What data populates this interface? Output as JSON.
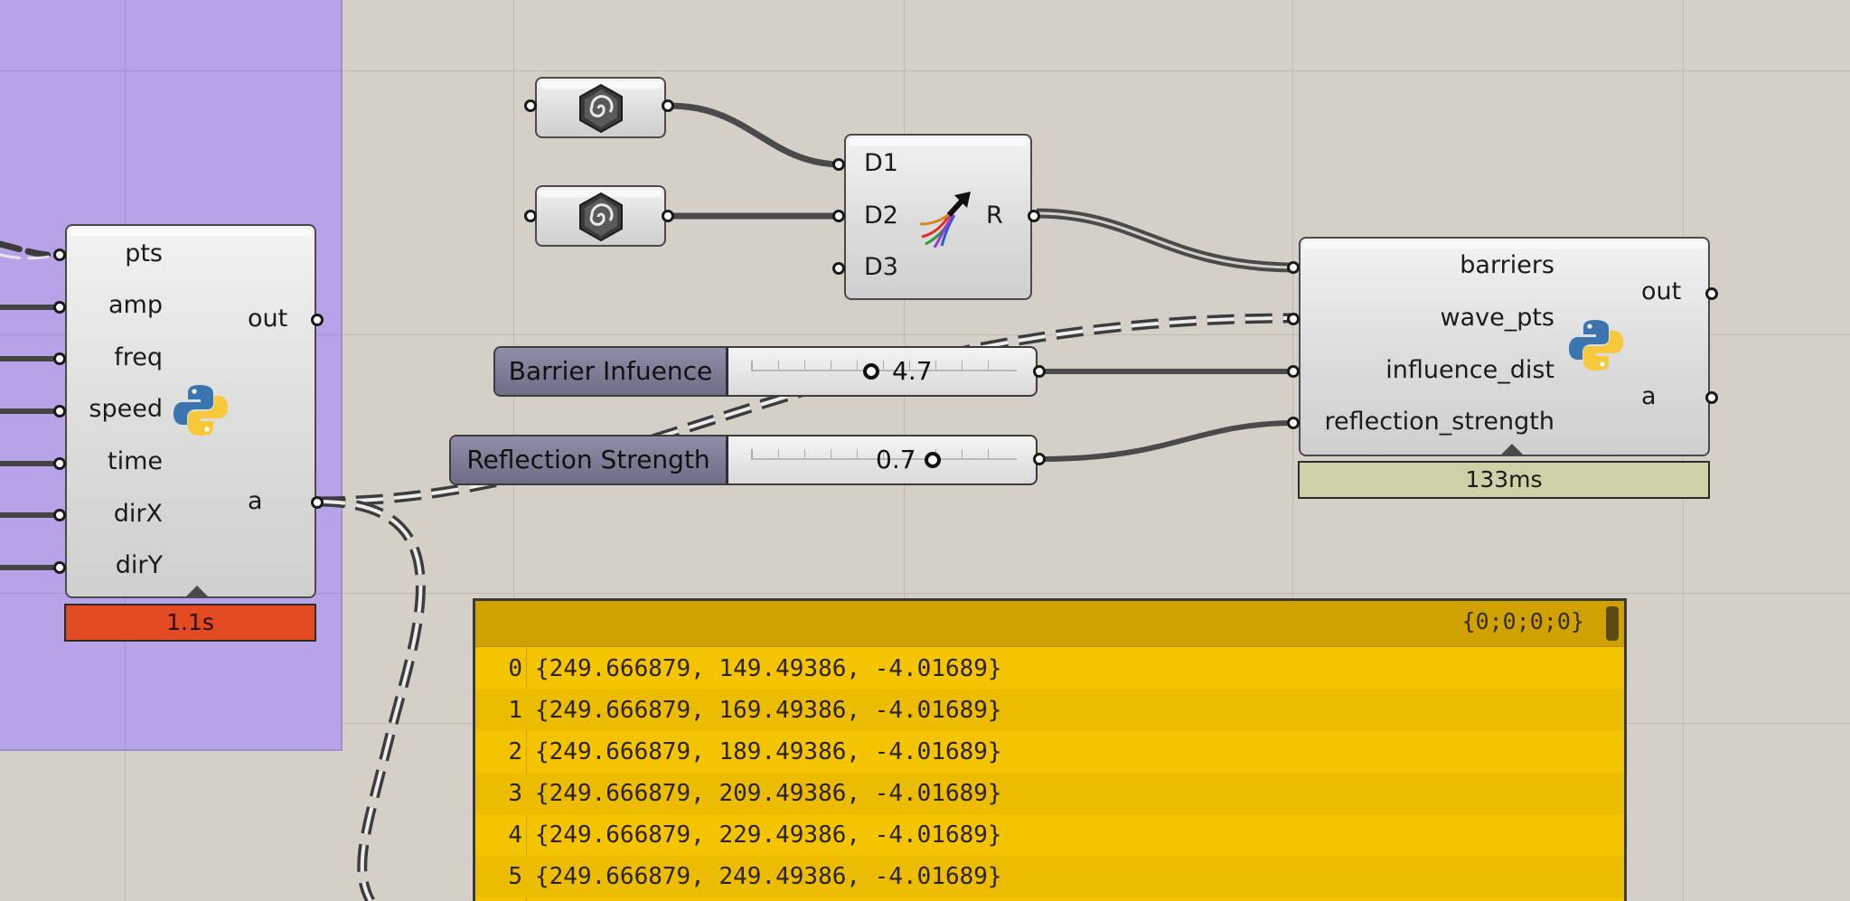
{
  "component_left": {
    "inputs": [
      "pts",
      "amp",
      "freq",
      "speed",
      "time",
      "dirX",
      "dirY"
    ],
    "outputs": [
      "out",
      "a"
    ],
    "icon": "python-icon",
    "timer": "1.1s"
  },
  "merge": {
    "inputs": [
      "D1",
      "D2",
      "D3"
    ],
    "output": "R",
    "icon": "merge-arrows-icon"
  },
  "component_right": {
    "inputs": [
      "barriers",
      "wave_pts",
      "influence_dist",
      "reflection_strength"
    ],
    "outputs": [
      "out",
      "a"
    ],
    "icon": "python-icon",
    "timer": "133ms"
  },
  "sliders": [
    {
      "name": "Barrier Infuence",
      "value": "4.7"
    },
    {
      "name": "Reflection Strength",
      "value": "0.7"
    }
  ],
  "geometry_params": [
    {
      "icon": "geometry-parameter-icon"
    },
    {
      "icon": "geometry-parameter-icon"
    }
  ],
  "panel": {
    "path": "{0;0;0;0}",
    "rows": [
      {
        "index": "0",
        "value": "{249.666879, 149.49386, -4.01689}"
      },
      {
        "index": "1",
        "value": "{249.666879, 169.49386, -4.01689}"
      },
      {
        "index": "2",
        "value": "{249.666879, 189.49386, -4.01689}"
      },
      {
        "index": "3",
        "value": "{249.666879, 209.49386, -4.01689}"
      },
      {
        "index": "4",
        "value": "{249.666879, 229.49386, -4.01689}"
      },
      {
        "index": "5",
        "value": "{249.666879, 249.49386, -4.01689}"
      }
    ]
  },
  "colors": {
    "canvas": "#d4d0c8",
    "group": "#b8a2e8",
    "panel": "#f5c400",
    "timer_slow": "#e24a22",
    "timer_ok": "#cfcfa8"
  }
}
